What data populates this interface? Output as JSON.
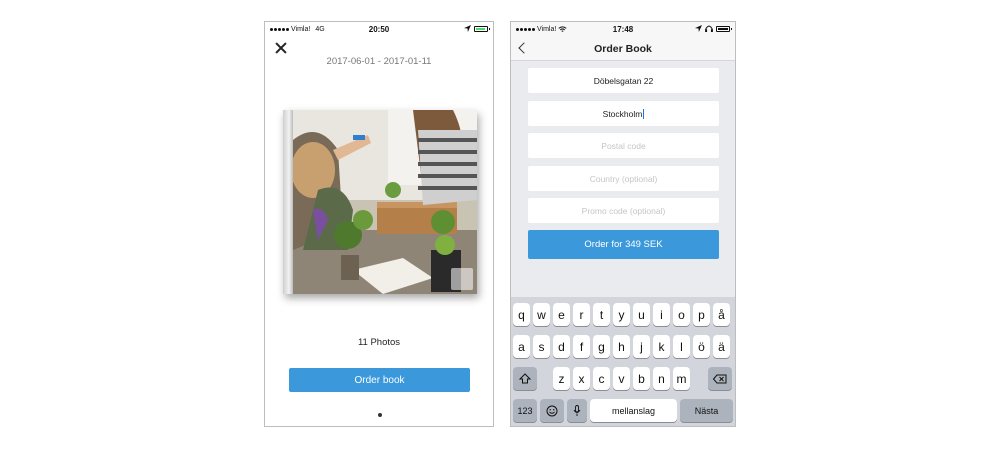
{
  "left_screen": {
    "status": {
      "carrier": "Vimla!",
      "network": "4G",
      "time": "20:50"
    },
    "date_range": "2017-06-01 - 2017-01-11",
    "photo_count": "11 Photos",
    "order_button": "Order book"
  },
  "right_screen": {
    "status": {
      "carrier": "Vimla!",
      "time": "17:48"
    },
    "title": "Order Book",
    "fields": {
      "street": "Döbelsgatan 22",
      "city": "Stockholm",
      "postal_placeholder": "Postal code",
      "country_placeholder": "Country (optional)",
      "promo_placeholder": "Promo code (optional)"
    },
    "order_button": "Order for 349 SEK",
    "keyboard": {
      "row1": [
        "q",
        "w",
        "e",
        "r",
        "t",
        "y",
        "u",
        "i",
        "o",
        "p",
        "å"
      ],
      "row2": [
        "a",
        "s",
        "d",
        "f",
        "g",
        "h",
        "j",
        "k",
        "l",
        "ö",
        "ä"
      ],
      "row3": [
        "z",
        "x",
        "c",
        "v",
        "b",
        "n",
        "m"
      ],
      "numbers_key": "123",
      "space_key": "mellanslag",
      "next_key": "Nästa"
    }
  },
  "colors": {
    "accent": "#3a98db",
    "keyboard_bg": "#d2d5db",
    "battery_green": "#4cd964"
  },
  "icons": [
    "close-icon",
    "expand-icon",
    "back-chevron-icon",
    "location-icon",
    "headphones-icon",
    "wifi-icon",
    "shift-icon",
    "emoji-icon",
    "microphone-icon",
    "backspace-icon"
  ]
}
